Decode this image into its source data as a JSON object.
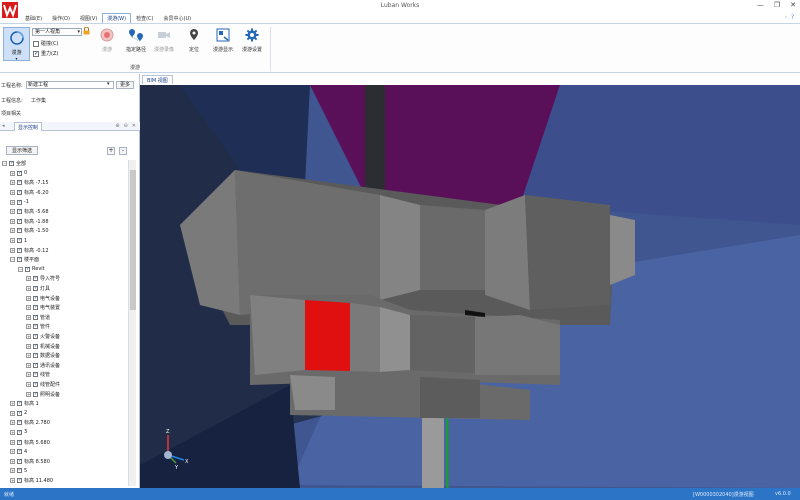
{
  "app": {
    "title": "Luban Works",
    "min": "—",
    "max": "❐",
    "close": "✕"
  },
  "menu": {
    "items": [
      "基础(E)",
      "操作(O)",
      "视图(V)",
      "漫游(W)",
      "检查(C)",
      "会员中心(U)"
    ],
    "active_index": 3,
    "right": [
      "◦",
      "?"
    ]
  },
  "ribbon": {
    "roam_label": "漫游",
    "view_select": "第一人视角",
    "collision_label": "碰撞(C)",
    "gravity_label": "重力(Z)",
    "collision_checked": false,
    "gravity_checked": true,
    "buttons": [
      {
        "label": "漫游",
        "icon": "record-icon",
        "enabled": false
      },
      {
        "label": "指定路径",
        "icon": "path-icon",
        "enabled": true
      },
      {
        "label": "漫游录像",
        "icon": "camera-icon",
        "enabled": false
      },
      {
        "label": "定位",
        "icon": "locate-icon",
        "enabled": true
      },
      {
        "label": "漫游显示",
        "icon": "display-icon",
        "enabled": true
      },
      {
        "label": "漫游设置",
        "icon": "settings-icon",
        "enabled": true
      }
    ],
    "group_label": "漫游"
  },
  "left_panel": {
    "project_label": "工程名称:",
    "project_value": "新建工程",
    "sync_label": "更多",
    "info_label": "工程信息:",
    "info_value": "工作集",
    "related_label": "项目相关",
    "tab_label": "显示控制",
    "tab_controls": [
      "⊕",
      "⊖",
      "✕"
    ],
    "filter_label": "显示筛选",
    "plus": "+",
    "minus": "-",
    "tree": [
      {
        "level": 0,
        "label": "全部",
        "expanded": true
      },
      {
        "level": 1,
        "label": "0"
      },
      {
        "level": 1,
        "label": "标高 -7.15"
      },
      {
        "level": 1,
        "label": "标高 -6.20"
      },
      {
        "level": 1,
        "label": "-1"
      },
      {
        "level": 1,
        "label": "标高 -5.68"
      },
      {
        "level": 1,
        "label": "标高 -1.88"
      },
      {
        "level": 1,
        "label": "标高 -1.50"
      },
      {
        "level": 1,
        "label": "1"
      },
      {
        "level": 1,
        "label": "标高 -0.12"
      },
      {
        "level": 1,
        "label": "楼平面",
        "expanded": true
      },
      {
        "level": 2,
        "label": "Revit",
        "expanded": true
      },
      {
        "level": 3,
        "label": "导入符号"
      },
      {
        "level": 3,
        "label": "灯具"
      },
      {
        "level": 3,
        "label": "电气设备"
      },
      {
        "level": 3,
        "label": "电气装置"
      },
      {
        "level": 3,
        "label": "管道"
      },
      {
        "level": 3,
        "label": "管件"
      },
      {
        "level": 3,
        "label": "火警设备"
      },
      {
        "level": 3,
        "label": "机械设备"
      },
      {
        "level": 3,
        "label": "数据设备"
      },
      {
        "level": 3,
        "label": "通讯设备"
      },
      {
        "level": 3,
        "label": "线管"
      },
      {
        "level": 3,
        "label": "线管配件"
      },
      {
        "level": 3,
        "label": "照明设备"
      },
      {
        "level": 1,
        "label": "标高 1"
      },
      {
        "level": 1,
        "label": "2"
      },
      {
        "level": 1,
        "label": "标高 2.780"
      },
      {
        "level": 1,
        "label": "3"
      },
      {
        "level": 1,
        "label": "标高 5.680"
      },
      {
        "level": 1,
        "label": "4"
      },
      {
        "level": 1,
        "label": "标高 8.580"
      },
      {
        "level": 1,
        "label": "5"
      },
      {
        "level": 1,
        "label": "标高 11.480"
      }
    ]
  },
  "view": {
    "tab_label": "BIM 视图",
    "axis_z": "Z",
    "axis_x": "X",
    "axis_y": "Y"
  },
  "status": {
    "left": "就绪",
    "mid": "[W0000302040]漫游视图",
    "right": "v6.0.0"
  },
  "colors": {
    "accent": "#2b74c6",
    "ceiling": "#5a0f59",
    "wall": "#3f5690",
    "floor": "#243a70",
    "duct": "#6a6a6a",
    "highlight": "#e01010",
    "pipe": "#1b9a3a"
  }
}
